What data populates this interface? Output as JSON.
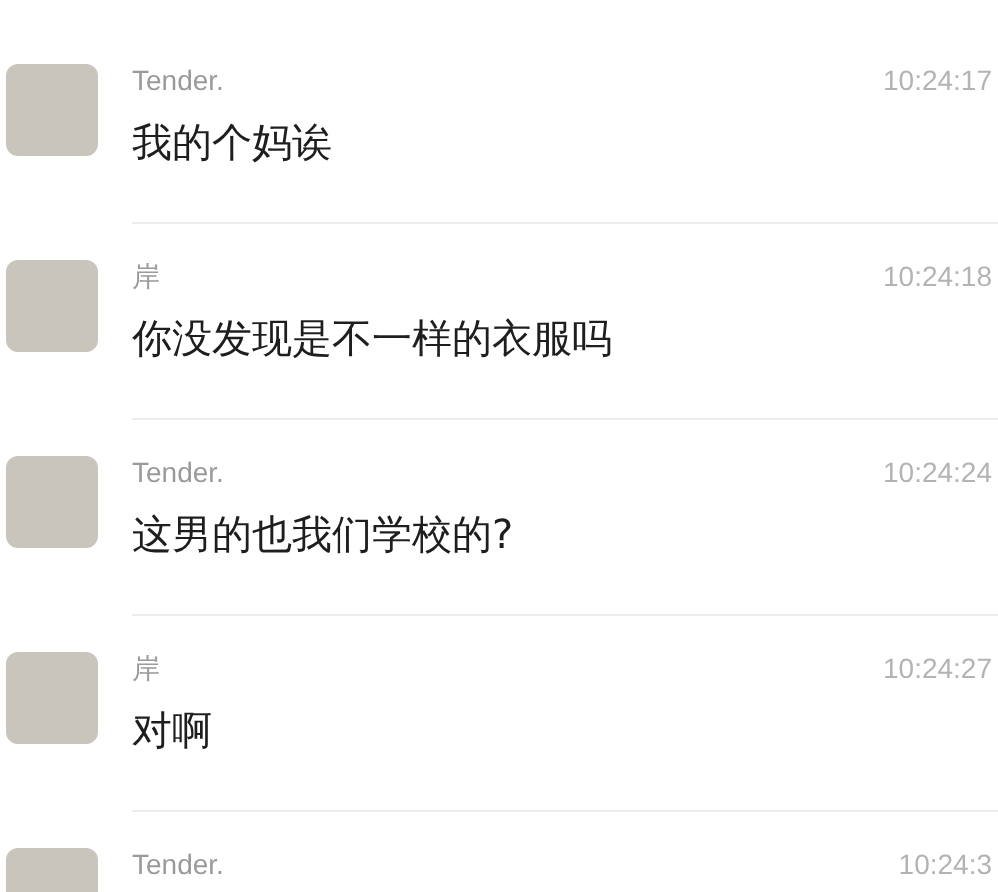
{
  "messages": [
    {
      "sender": "Tender.",
      "time": "10:24:17",
      "text": "我的个妈诶"
    },
    {
      "sender": "岸",
      "time": "10:24:18",
      "text": "你没发现是不一样的衣服吗"
    },
    {
      "sender": "Tender.",
      "time": "10:24:24",
      "text": "这男的也我们学校的?"
    },
    {
      "sender": "岸",
      "time": "10:24:27",
      "text": "对啊"
    },
    {
      "sender": "Tender.",
      "time": "10:24:3"
    }
  ]
}
